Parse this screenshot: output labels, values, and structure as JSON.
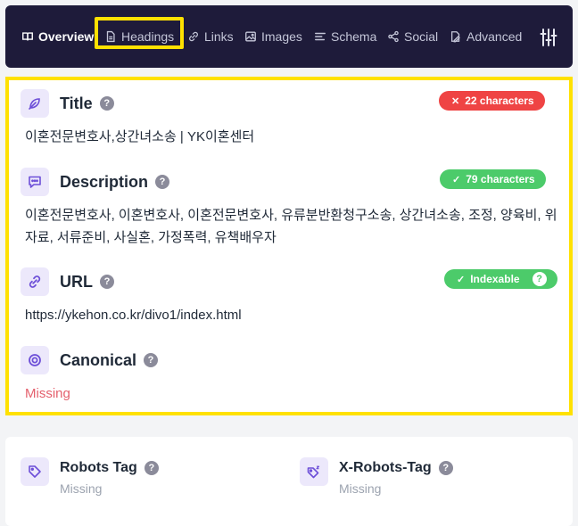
{
  "nav": {
    "tabs": [
      {
        "label": "Overview",
        "icon": "book-icon",
        "active": true
      },
      {
        "label": "Headings",
        "icon": "document-icon",
        "active": false
      },
      {
        "label": "Links",
        "icon": "link-icon",
        "active": false
      },
      {
        "label": "Images",
        "icon": "image-icon",
        "active": false
      },
      {
        "label": "Schema",
        "icon": "lines-icon",
        "active": false
      },
      {
        "label": "Social",
        "icon": "share-icon",
        "active": false
      },
      {
        "label": "Advanced",
        "icon": "advanced-icon",
        "active": false
      }
    ],
    "settings_icon": "sliders-icon"
  },
  "sections": {
    "title": {
      "label": "Title",
      "badge": "22 characters",
      "badge_status": "error",
      "value": "이혼전문변호사,상간녀소송 | YK이혼센터"
    },
    "description": {
      "label": "Description",
      "badge": "79 characters",
      "badge_status": "ok",
      "value": "이혼전문변호사, 이혼변호사, 이혼전문변호사, 유류분반환청구소송, 상간녀소송, 조정, 양육비, 위자료, 서류준비, 사실혼, 가정폭력, 유책배우자"
    },
    "url": {
      "label": "URL",
      "badge": "Indexable",
      "badge_status": "ok",
      "value": "https://ykehon.co.kr/divo1/index.html"
    },
    "canonical": {
      "label": "Canonical",
      "value": "Missing"
    }
  },
  "robots": {
    "robots_tag": {
      "label": "Robots Tag",
      "value": "Missing"
    },
    "x_robots_tag": {
      "label": "X-Robots-Tag",
      "value": "Missing"
    }
  },
  "help_glyph": "?",
  "colors": {
    "nav_bg": "#1e1b3a",
    "highlight": "#ffe100",
    "error": "#ef4444",
    "ok": "#4ccb6a",
    "icon_accent": "#6d4fd8",
    "missing": "#e4606d"
  }
}
